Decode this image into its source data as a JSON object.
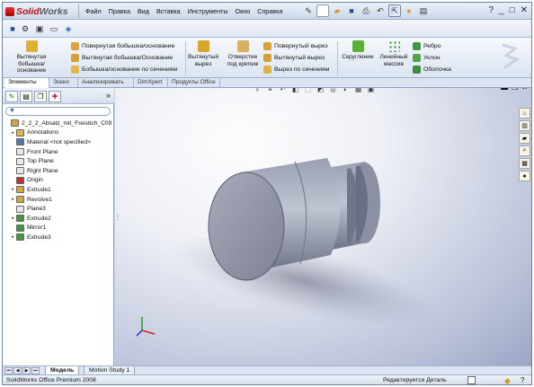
{
  "app": {
    "name_part1": "Solid",
    "name_part2": "Works"
  },
  "menu": [
    "Файл",
    "Правка",
    "Вид",
    "Вставка",
    "Инструменты",
    "Окно",
    "Справка"
  ],
  "window_buttons": {
    "help": "?",
    "minimize": "_",
    "maximize": "□",
    "close": "✕"
  },
  "command_manager": {
    "extrude_boss": "Вытянутая бобышка/основание",
    "revolve_boss": "Повернутая бобышка/основание",
    "swept_boss": "Вытянутая бобышка/Основание",
    "loft_boss": "Бобышка/основание по сечениям",
    "extruded_cut": "Вытянутый вырез",
    "hole_wizard": "Отверстие под крепеж",
    "revolved_cut": "Повернутый вырез",
    "swept_cut": "Вытянутый вырез",
    "loft_cut": "Вырез по сечениям",
    "fillet": "Скругление",
    "linear_pattern": "Линейный массив",
    "rib": "Ребро",
    "draft": "Уклон",
    "shell": "Оболочка"
  },
  "tabs": [
    "Элементы",
    "Эскиз",
    "Анализировать",
    "DimXpert",
    "Продукты Office"
  ],
  "tree": {
    "root": "2_2_2_Absatz_mit_Freistich_C09",
    "items": [
      {
        "label": "Annotations",
        "exp": "▸",
        "color": "#e3b33a",
        "indent": 1
      },
      {
        "label": "Material <not specified>",
        "exp": "",
        "color": "#5577aa",
        "indent": 1
      },
      {
        "label": "Front Plane",
        "exp": "",
        "color": "#e8e8e8",
        "indent": 1
      },
      {
        "label": "Top Plane",
        "exp": "",
        "color": "#e8e8e8",
        "indent": 1
      },
      {
        "label": "Right Plane",
        "exp": "",
        "color": "#e8e8e8",
        "indent": 1
      },
      {
        "label": "Origin",
        "exp": "",
        "color": "#c03030",
        "indent": 1
      },
      {
        "label": "Extrude1",
        "exp": "▸",
        "color": "#d6a63a",
        "indent": 1
      },
      {
        "label": "Revolve1",
        "exp": "▸",
        "color": "#d6a63a",
        "indent": 1
      },
      {
        "label": "Plane3",
        "exp": "",
        "color": "#e8e8e8",
        "indent": 1
      },
      {
        "label": "Extrude2",
        "exp": "▸",
        "color": "#3f9a3f",
        "indent": 1
      },
      {
        "label": "Mirror1",
        "exp": "",
        "color": "#3f9a3f",
        "indent": 1
      },
      {
        "label": "Extrude3",
        "exp": "▸",
        "color": "#3f9a3f",
        "indent": 1
      }
    ]
  },
  "bottom_tabs": [
    "Модель",
    "Motion Study 1"
  ],
  "status": {
    "left": "SolidWorks Office Premium 2008",
    "right": "Редактируется Деталь"
  }
}
